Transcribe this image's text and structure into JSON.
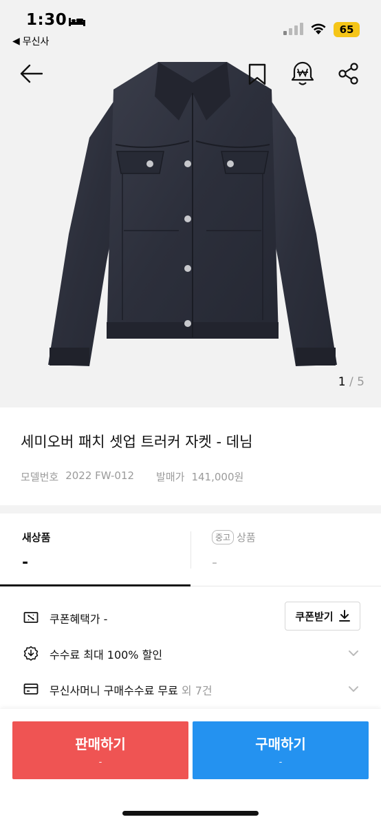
{
  "status_bar": {
    "time": "1:30",
    "back_app": "무신사",
    "battery": "65",
    "battery_color": "#f5c518"
  },
  "nav": {
    "back_icon": "arrow-left-icon",
    "bookmark_icon": "bookmark-icon",
    "price_alert_icon": "price-alert-bell-icon",
    "share_icon": "share-icon"
  },
  "gallery": {
    "current": "1",
    "separator": "/",
    "total": "5"
  },
  "product": {
    "title": "세미오버 패치 셋업 트러커 자켓 - 데님",
    "model_label": "모델번호",
    "model_value": "2022 FW-012",
    "release_label": "발매가",
    "release_value": "141,000원"
  },
  "tabs": {
    "new_label": "새상품",
    "new_price": "-",
    "used_badge": "중고",
    "used_label": "상품",
    "used_price": "-"
  },
  "benefits": {
    "coupon_text": "쿠폰혜택가 -",
    "coupon_button": "쿠폰받기",
    "fee_text": "수수료 최대 100% 할인",
    "money_text": "무신사머니 구매수수료 무료",
    "money_sub": " 외 7건"
  },
  "actions": {
    "sell_label": "판매하기",
    "sell_sub": "-",
    "buy_label": "구매하기",
    "buy_sub": "-",
    "sell_color": "#ef5453",
    "buy_color": "#2492f0"
  }
}
